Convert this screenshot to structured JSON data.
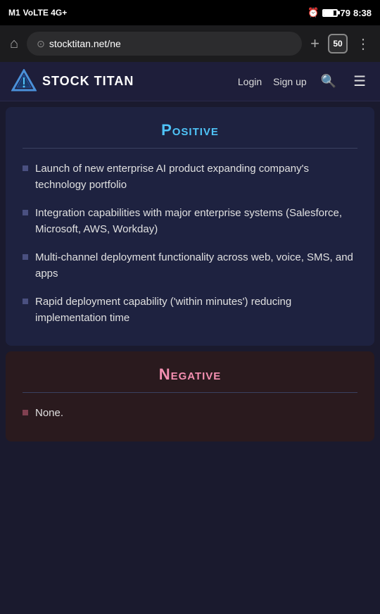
{
  "statusBar": {
    "carrier": "M1",
    "networkType": "VoLTE 4G+",
    "time": "8:38",
    "batteryLevel": 79,
    "alarmIcon": "⏰"
  },
  "addressBar": {
    "url": "stocktitan.net/ne",
    "tabCount": "50",
    "homeLabel": "⌂",
    "plusLabel": "+",
    "menuLabel": "⋮"
  },
  "navbar": {
    "logoText": "STOCK TITAN",
    "loginLabel": "Login",
    "signupLabel": "Sign up"
  },
  "positive": {
    "title": "Positive",
    "items": [
      "Launch of new enterprise AI product expanding company's technology portfolio",
      "Integration capabilities with major enterprise systems (Salesforce, Microsoft, AWS, Workday)",
      "Multi-channel deployment functionality across web, voice, SMS, and apps",
      "Rapid deployment capability ('within minutes') reducing implementation time"
    ]
  },
  "negative": {
    "title": "Negative",
    "items": [
      "None."
    ]
  }
}
